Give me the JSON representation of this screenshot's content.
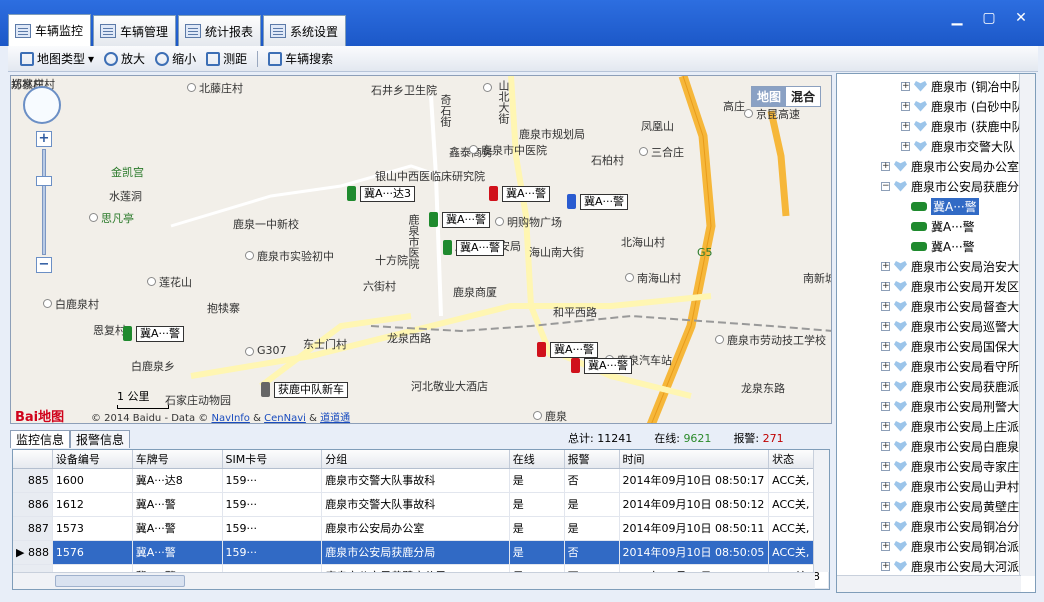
{
  "tabs": [
    "车辆监控",
    "车辆管理",
    "统计报表",
    "系统设置"
  ],
  "toolbar": {
    "map_type": "地图类型",
    "zoom_in": "放大",
    "zoom_out": "缩小",
    "measure": "测距",
    "search": "车辆搜索"
  },
  "map": {
    "type_map": "地图",
    "type_mixed": "混合",
    "scale": "1 公里",
    "logo": "Bai地图",
    "copyright": "© 2014 Baidu - Data ©",
    "navinfo": "NavInfo",
    "amp1": "&",
    "cennavi": "CenNavi",
    "amp2": "&",
    "daodaotong": "道道通",
    "labels": [
      "北藤庄村",
      "石井乡卫生院",
      "奇石街",
      "山北大街",
      "鹿泉市规划局",
      "凤凰山",
      "京昆高速",
      "高庄",
      "鑫泰商务",
      "三合庄",
      "金凯宫",
      "银山中西医临床研究院",
      "鹿泉市中医院",
      "石柏村",
      "水莲洞",
      "思凡亭",
      "鹿泉一中新校",
      "鹿泉市医院",
      "明购物广场",
      "鹿泉市公安局",
      "北海山村",
      "鹿泉市实验初中",
      "十方院",
      "海山南大街",
      "南海山村",
      "南新城",
      "G5",
      "莲花山",
      "六街村",
      "鹿泉商厦",
      "白鹿泉村",
      "抱犊寨",
      "和平西路",
      "鹿泉市劳动技工学校",
      "恩复村",
      "白鹿泉乡",
      "G307",
      "东士门村",
      "龙泉西路",
      "鹿泉汽车站",
      "龙泉东路",
      "河北敬业大酒店",
      "鹿泉",
      "石家庄动物园",
      "郑家庄村",
      "坊林村"
    ],
    "plates": [
      "冀A···警",
      "冀A···警",
      "冀A···警",
      "冀A···警",
      "冀A···达3",
      "冀A···警",
      "冀A···警",
      "冀A···警",
      "获鹿中队新车"
    ]
  },
  "bottom": {
    "tab_monitor": "监控信息",
    "tab_alarm": "报警信息",
    "total_label": "总计:",
    "total": "11241",
    "online_label": "在线:",
    "online": "9621",
    "alarm_label": "报警:",
    "alarm": "271"
  },
  "grid": {
    "headers": [
      "设备编号",
      "车牌号",
      "SIM卡号",
      "分组",
      "在线",
      "报警",
      "时间",
      "状态"
    ],
    "rows": [
      {
        "idx": "885",
        "dev": "1600",
        "plate": "冀A···达8",
        "sim": "159···",
        "group": "鹿泉市交警大队事故科",
        "online": "是",
        "alarm": "否",
        "time": "2014年09月10日  08:50:17",
        "status": "ACC关, 8"
      },
      {
        "idx": "886",
        "dev": "1612",
        "plate": "冀A···警",
        "sim": "159···",
        "group": "鹿泉市交警大队事故科",
        "online": "是",
        "alarm": "是",
        "time": "2014年09月10日  08:50:12",
        "status": "ACC关, 8"
      },
      {
        "idx": "887",
        "dev": "1573",
        "plate": "冀A···警",
        "sim": "159···",
        "group": "鹿泉市公安局办公室",
        "online": "是",
        "alarm": "是",
        "time": "2014年09月10日  08:50:11",
        "status": "ACC关, 8"
      },
      {
        "idx": "888",
        "dev": "1576",
        "plate": "冀A···警",
        "sim": "159···",
        "group": "鹿泉市公安局获鹿分局",
        "online": "是",
        "alarm": "否",
        "time": "2014年09月10日  08:50:05",
        "status": "ACC关, 8"
      },
      {
        "idx": "889",
        "dev": "1577",
        "plate": "冀A···警",
        "sim": "159···",
        "group": "鹿泉市公安局黄壁庄分局",
        "online": "是",
        "alarm": "否",
        "time": "2014年09月10日  08:50:02",
        "status": "ACC关, 8"
      }
    ]
  },
  "tree": [
    {
      "label": "鹿泉市 (铜冶中队)",
      "lvl": 2
    },
    {
      "label": "鹿泉市 (白砂中队)",
      "lvl": 2
    },
    {
      "label": "鹿泉市 (获鹿中队)",
      "lvl": 2
    },
    {
      "label": "鹿泉市交警大队",
      "lvl": 2
    },
    {
      "label": "鹿泉市公安局办公室",
      "lvl": 1
    },
    {
      "label": "鹿泉市公安局获鹿分局",
      "lvl": 1,
      "open": true
    },
    {
      "label": "冀A···警",
      "lvl": 3,
      "car": true,
      "sel": true
    },
    {
      "label": "冀A···警",
      "lvl": 3,
      "car": true
    },
    {
      "label": "冀A···警",
      "lvl": 3,
      "car": true
    },
    {
      "label": "鹿泉市公安局治安大队",
      "lvl": 1
    },
    {
      "label": "鹿泉市公安局开发区分局",
      "lvl": 1
    },
    {
      "label": "鹿泉市公安局督查大队",
      "lvl": 1
    },
    {
      "label": "鹿泉市公安局巡警大队",
      "lvl": 1
    },
    {
      "label": "鹿泉市公安局国保大队",
      "lvl": 1
    },
    {
      "label": "鹿泉市公安局看守所",
      "lvl": 1
    },
    {
      "label": "鹿泉市公安局获鹿派出所",
      "lvl": 1
    },
    {
      "label": "鹿泉市公安局刑警大队",
      "lvl": 1
    },
    {
      "label": "鹿泉市公安局上庄派出所",
      "lvl": 1
    },
    {
      "label": "鹿泉市公安局白鹿泉派出所",
      "lvl": 1
    },
    {
      "label": "鹿泉市公安局寺家庄派出所",
      "lvl": 1
    },
    {
      "label": "鹿泉市公安局山尹村派出所",
      "lvl": 1
    },
    {
      "label": "鹿泉市公安局黄壁庄分局",
      "lvl": 1
    },
    {
      "label": "鹿泉市公安局铜冶分局",
      "lvl": 1
    },
    {
      "label": "鹿泉市公安局铜冶派出所",
      "lvl": 1
    },
    {
      "label": "鹿泉市公安局大河派出所",
      "lvl": 1
    }
  ]
}
